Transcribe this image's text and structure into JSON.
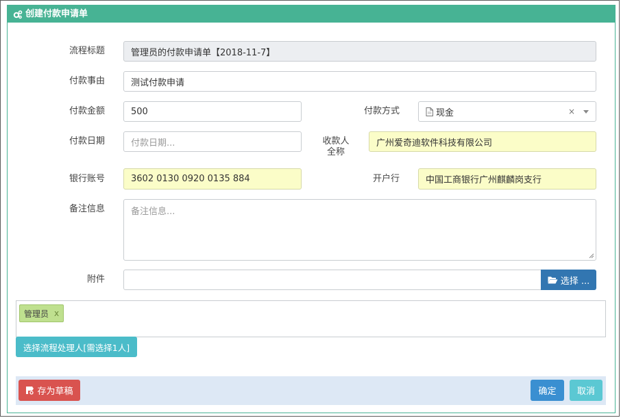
{
  "header": {
    "title": "创建付款申请单",
    "icon": "gears-icon"
  },
  "form": {
    "flow_title": {
      "label": "流程标题",
      "value": "管理员的付款申请单【2018-11-7】"
    },
    "reason": {
      "label": "付款事由",
      "value": "测试付款申请"
    },
    "amount": {
      "label": "付款金额",
      "value": "500"
    },
    "method": {
      "label": "付款方式",
      "value": "现金",
      "clear": "×"
    },
    "date": {
      "label": "付款日期",
      "placeholder": "付款日期..."
    },
    "payee": {
      "label_line1": "收款人",
      "label_line2": "全称",
      "value": "广州爱奇迪软件科技有限公司"
    },
    "account": {
      "label": "银行账号",
      "value": "3602 0130 0920 0135 884"
    },
    "bank": {
      "label": "开户行",
      "value": "中国工商银行广州麒麟岗支行"
    },
    "remark": {
      "label": "备注信息",
      "placeholder": "备注信息..."
    },
    "attachment": {
      "label": "附件",
      "button": "选择 ..."
    }
  },
  "assignees": {
    "tags": [
      {
        "name": "管理员",
        "remove": "x"
      }
    ],
    "select_button": "选择流程处理人[需选择1人]"
  },
  "footer": {
    "save_draft": "存为草稿",
    "confirm": "确定",
    "cancel": "取消"
  },
  "colors": {
    "header": "#47b394",
    "highlight_field": "#fbfdc8",
    "primary": "#3276b1",
    "danger": "#d9534f",
    "info": "#4bbcc9",
    "footer_bg": "#dde8f5",
    "tag": "#bfe08f"
  }
}
